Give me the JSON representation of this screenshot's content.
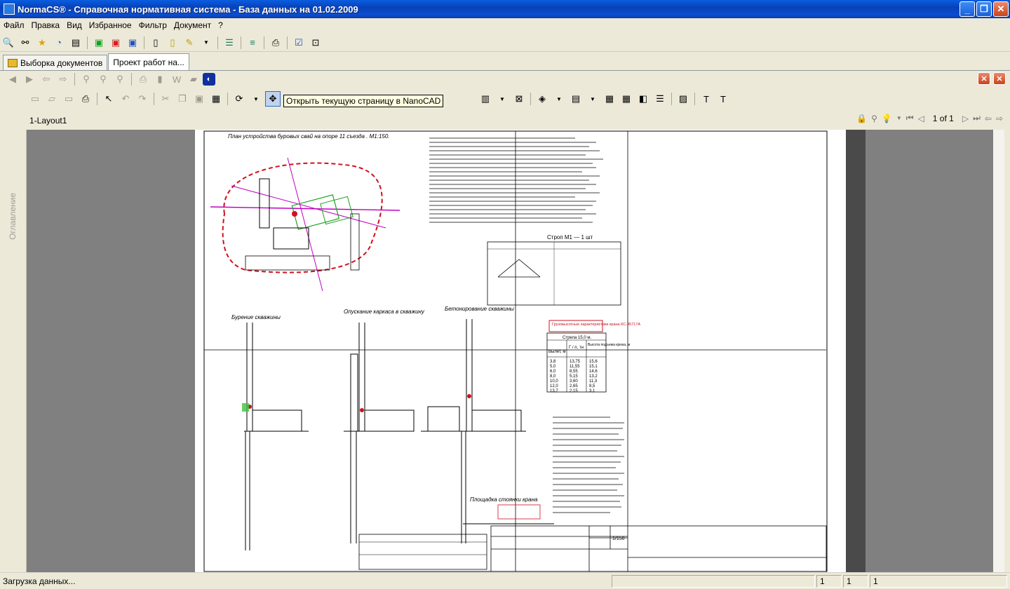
{
  "window": {
    "title": "NormaCS® - Справочная нормативная система - База данных на 01.02.2009"
  },
  "menu": [
    "Файл",
    "Правка",
    "Вид",
    "Избранное",
    "Фильтр",
    "Документ",
    "?"
  ],
  "tabs": [
    {
      "label": "Выборка документов"
    },
    {
      "label": "Проект работ на..."
    }
  ],
  "viewer": {
    "tooltip": "Открыть текущую страницу в NanoCAD",
    "layout_label": "1-Layout1",
    "page_info": "1 of 1",
    "sidebar_label": "Оглавление"
  },
  "drawing": {
    "title_plan": "План устройства буровых свай на опоре 11 съезда . М1:150.",
    "label_boring": "Бурение скважины",
    "label_cage": "Опускание каркаса в скважину",
    "label_concrete": "Бетонирование скважины",
    "label_crane_pad": "Площадка стоянки крана",
    "label_strop": "Строп М1 — 1 шт",
    "crane_chars_title": "Грузовысотные характеристики крана КС-45717А",
    "crane_table": {
      "boom": "Стрела 15,0 м.",
      "headers": [
        "Вылет, м",
        "Г / п, тн",
        "Высота подъема крюка, м"
      ],
      "rows": [
        [
          "3,8",
          "13,75",
          "15,6"
        ],
        [
          "5,0",
          "11,55",
          "15,1"
        ],
        [
          "6,0",
          "8,55",
          "14,6"
        ],
        [
          "8,0",
          "5,15",
          "13,2"
        ],
        [
          "10,0",
          "3,60",
          "11,3"
        ],
        [
          "12,0",
          "2,65",
          "8,5"
        ],
        [
          "13,7",
          "2,15",
          "3,1"
        ]
      ]
    },
    "scale": "1/150"
  },
  "status": {
    "message": "Загрузка данных...",
    "cells": [
      "1",
      "1",
      "1"
    ]
  }
}
